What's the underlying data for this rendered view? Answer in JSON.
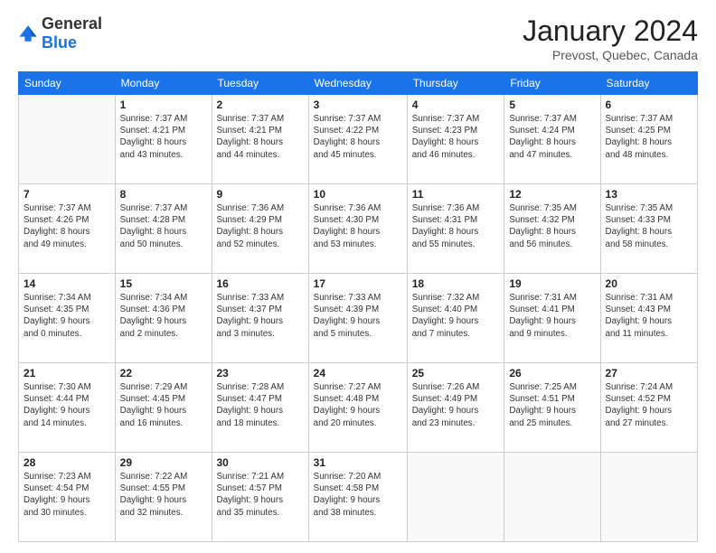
{
  "header": {
    "logo_general": "General",
    "logo_blue": "Blue",
    "month_year": "January 2024",
    "location": "Prevost, Quebec, Canada"
  },
  "days_of_week": [
    "Sunday",
    "Monday",
    "Tuesday",
    "Wednesday",
    "Thursday",
    "Friday",
    "Saturday"
  ],
  "weeks": [
    [
      {
        "day": "",
        "info": ""
      },
      {
        "day": "1",
        "info": "Sunrise: 7:37 AM\nSunset: 4:21 PM\nDaylight: 8 hours\nand 43 minutes."
      },
      {
        "day": "2",
        "info": "Sunrise: 7:37 AM\nSunset: 4:21 PM\nDaylight: 8 hours\nand 44 minutes."
      },
      {
        "day": "3",
        "info": "Sunrise: 7:37 AM\nSunset: 4:22 PM\nDaylight: 8 hours\nand 45 minutes."
      },
      {
        "day": "4",
        "info": "Sunrise: 7:37 AM\nSunset: 4:23 PM\nDaylight: 8 hours\nand 46 minutes."
      },
      {
        "day": "5",
        "info": "Sunrise: 7:37 AM\nSunset: 4:24 PM\nDaylight: 8 hours\nand 47 minutes."
      },
      {
        "day": "6",
        "info": "Sunrise: 7:37 AM\nSunset: 4:25 PM\nDaylight: 8 hours\nand 48 minutes."
      }
    ],
    [
      {
        "day": "7",
        "info": "Sunrise: 7:37 AM\nSunset: 4:26 PM\nDaylight: 8 hours\nand 49 minutes."
      },
      {
        "day": "8",
        "info": "Sunrise: 7:37 AM\nSunset: 4:28 PM\nDaylight: 8 hours\nand 50 minutes."
      },
      {
        "day": "9",
        "info": "Sunrise: 7:36 AM\nSunset: 4:29 PM\nDaylight: 8 hours\nand 52 minutes."
      },
      {
        "day": "10",
        "info": "Sunrise: 7:36 AM\nSunset: 4:30 PM\nDaylight: 8 hours\nand 53 minutes."
      },
      {
        "day": "11",
        "info": "Sunrise: 7:36 AM\nSunset: 4:31 PM\nDaylight: 8 hours\nand 55 minutes."
      },
      {
        "day": "12",
        "info": "Sunrise: 7:35 AM\nSunset: 4:32 PM\nDaylight: 8 hours\nand 56 minutes."
      },
      {
        "day": "13",
        "info": "Sunrise: 7:35 AM\nSunset: 4:33 PM\nDaylight: 8 hours\nand 58 minutes."
      }
    ],
    [
      {
        "day": "14",
        "info": "Sunrise: 7:34 AM\nSunset: 4:35 PM\nDaylight: 9 hours\nand 0 minutes."
      },
      {
        "day": "15",
        "info": "Sunrise: 7:34 AM\nSunset: 4:36 PM\nDaylight: 9 hours\nand 2 minutes."
      },
      {
        "day": "16",
        "info": "Sunrise: 7:33 AM\nSunset: 4:37 PM\nDaylight: 9 hours\nand 3 minutes."
      },
      {
        "day": "17",
        "info": "Sunrise: 7:33 AM\nSunset: 4:39 PM\nDaylight: 9 hours\nand 5 minutes."
      },
      {
        "day": "18",
        "info": "Sunrise: 7:32 AM\nSunset: 4:40 PM\nDaylight: 9 hours\nand 7 minutes."
      },
      {
        "day": "19",
        "info": "Sunrise: 7:31 AM\nSunset: 4:41 PM\nDaylight: 9 hours\nand 9 minutes."
      },
      {
        "day": "20",
        "info": "Sunrise: 7:31 AM\nSunset: 4:43 PM\nDaylight: 9 hours\nand 11 minutes."
      }
    ],
    [
      {
        "day": "21",
        "info": "Sunrise: 7:30 AM\nSunset: 4:44 PM\nDaylight: 9 hours\nand 14 minutes."
      },
      {
        "day": "22",
        "info": "Sunrise: 7:29 AM\nSunset: 4:45 PM\nDaylight: 9 hours\nand 16 minutes."
      },
      {
        "day": "23",
        "info": "Sunrise: 7:28 AM\nSunset: 4:47 PM\nDaylight: 9 hours\nand 18 minutes."
      },
      {
        "day": "24",
        "info": "Sunrise: 7:27 AM\nSunset: 4:48 PM\nDaylight: 9 hours\nand 20 minutes."
      },
      {
        "day": "25",
        "info": "Sunrise: 7:26 AM\nSunset: 4:49 PM\nDaylight: 9 hours\nand 23 minutes."
      },
      {
        "day": "26",
        "info": "Sunrise: 7:25 AM\nSunset: 4:51 PM\nDaylight: 9 hours\nand 25 minutes."
      },
      {
        "day": "27",
        "info": "Sunrise: 7:24 AM\nSunset: 4:52 PM\nDaylight: 9 hours\nand 27 minutes."
      }
    ],
    [
      {
        "day": "28",
        "info": "Sunrise: 7:23 AM\nSunset: 4:54 PM\nDaylight: 9 hours\nand 30 minutes."
      },
      {
        "day": "29",
        "info": "Sunrise: 7:22 AM\nSunset: 4:55 PM\nDaylight: 9 hours\nand 32 minutes."
      },
      {
        "day": "30",
        "info": "Sunrise: 7:21 AM\nSunset: 4:57 PM\nDaylight: 9 hours\nand 35 minutes."
      },
      {
        "day": "31",
        "info": "Sunrise: 7:20 AM\nSunset: 4:58 PM\nDaylight: 9 hours\nand 38 minutes."
      },
      {
        "day": "",
        "info": ""
      },
      {
        "day": "",
        "info": ""
      },
      {
        "day": "",
        "info": ""
      }
    ]
  ]
}
